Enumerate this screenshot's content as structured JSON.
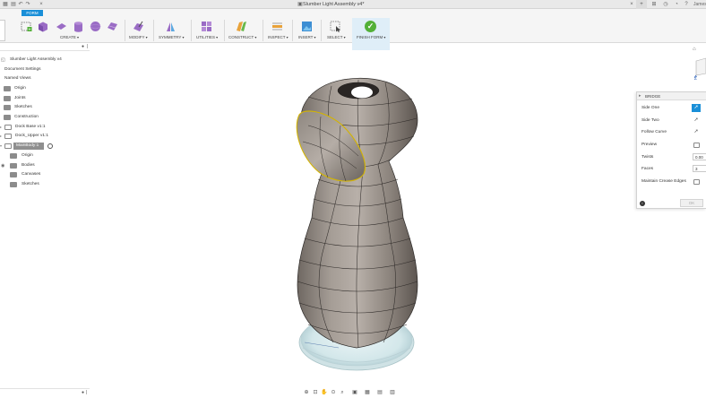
{
  "app": {
    "document_title": "Slumber Light Assembly v4*",
    "user_name": "James"
  },
  "ribbon": {
    "active_tab": "FORM",
    "groups": [
      {
        "label": "CREATE"
      },
      {
        "label": "MODIFY"
      },
      {
        "label": "SYMMETRY"
      },
      {
        "label": "UTILITIES"
      },
      {
        "label": "CONSTRUCT"
      },
      {
        "label": "INSPECT"
      },
      {
        "label": "INSERT"
      },
      {
        "label": "SELECT"
      },
      {
        "label": "FINISH FORM"
      }
    ]
  },
  "browser": {
    "root": "Slumber Light Assembly v4",
    "rows": [
      {
        "label": "Document Settings"
      },
      {
        "label": "Named Views"
      },
      {
        "label": "Origin"
      },
      {
        "label": "Joints"
      },
      {
        "label": "Sketches"
      },
      {
        "label": "Construction"
      },
      {
        "label": "Dock Base v1:1"
      },
      {
        "label": "Dock_Upper v1:1"
      },
      {
        "label": "MainBody:1"
      },
      {
        "label": "Origin"
      },
      {
        "label": "Bodies"
      },
      {
        "label": "Canvases"
      },
      {
        "label": "Sketches"
      }
    ]
  },
  "bridge": {
    "title": "BRIDGE",
    "params": [
      {
        "label": "Side One"
      },
      {
        "label": "Side Two"
      },
      {
        "label": "Follow Curve"
      },
      {
        "label": "Preview"
      },
      {
        "label": "Twists",
        "value": "0.00"
      },
      {
        "label": "Faces",
        "value": "3"
      },
      {
        "label": "Maintain Crease Edges"
      }
    ],
    "ok_label": "OK",
    "info_icon": "i"
  },
  "icons": {
    "accent": "#1a8fd8",
    "finish": "#52b038",
    "selection_edge": "#d4b400"
  }
}
